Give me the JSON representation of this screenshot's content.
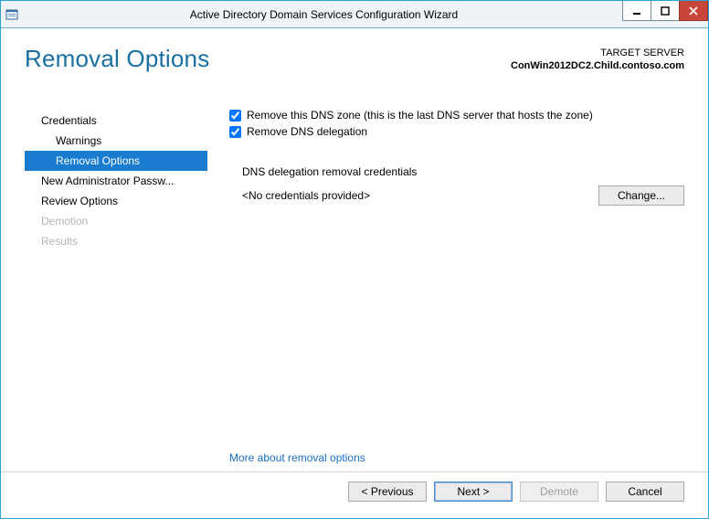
{
  "window": {
    "title": "Active Directory Domain Services Configuration Wizard"
  },
  "page": {
    "heading": "Removal Options"
  },
  "target": {
    "label": "TARGET SERVER",
    "value": "ConWin2012DC2.Child.contoso.com"
  },
  "nav": {
    "items": [
      {
        "label": "Credentials",
        "sub": false,
        "state": "enabled"
      },
      {
        "label": "Warnings",
        "sub": true,
        "state": "enabled"
      },
      {
        "label": "Removal Options",
        "sub": true,
        "state": "selected"
      },
      {
        "label": "New Administrator Passw...",
        "sub": false,
        "state": "enabled"
      },
      {
        "label": "Review Options",
        "sub": false,
        "state": "enabled"
      },
      {
        "label": "Demotion",
        "sub": false,
        "state": "disabled"
      },
      {
        "label": "Results",
        "sub": false,
        "state": "disabled"
      }
    ]
  },
  "options": {
    "remove_zone": {
      "label": "Remove this DNS zone (this is the last DNS server that hosts the zone)",
      "checked": true
    },
    "remove_delegation": {
      "label": "Remove DNS delegation",
      "checked": true
    },
    "credentials_section": "DNS delegation removal credentials",
    "credentials_value": "<No credentials provided>",
    "change_button": "Change...",
    "more_link": "More about removal options"
  },
  "footer": {
    "previous": "< Previous",
    "next": "Next >",
    "demote": "Demote",
    "cancel": "Cancel"
  }
}
